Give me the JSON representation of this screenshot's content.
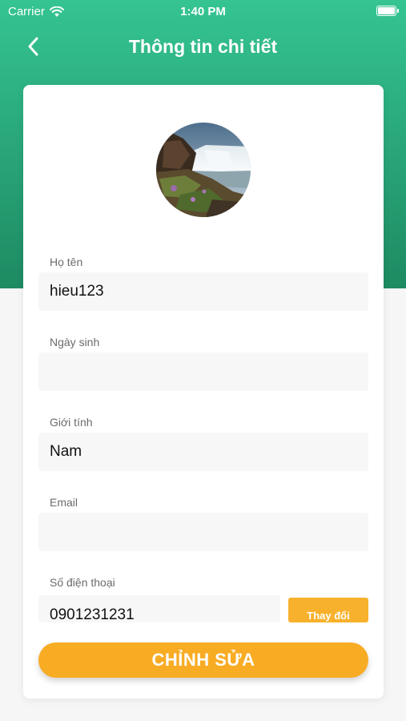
{
  "status_bar": {
    "carrier": "Carrier",
    "time": "1:40 PM",
    "battery_level": 1.0
  },
  "header": {
    "title": "Thông tin chi tiết",
    "back_icon": "chevron-left-icon"
  },
  "avatar": {
    "image": "waterfall landscape photo"
  },
  "fields": [
    {
      "label": "Họ tên",
      "value": "hieu123"
    },
    {
      "label": "Ngày sinh",
      "value": ""
    },
    {
      "label": "Giới tính",
      "value": "Nam"
    },
    {
      "label": "Email",
      "value": ""
    },
    {
      "label": "Số điện thoại",
      "value": "0901231231"
    }
  ],
  "phone_change_label": "Thay đổi",
  "edit_button_label": "CHỈNH SỬA",
  "colors": {
    "header_top": "#35c492",
    "header_bottom": "#1e8a62",
    "accent": "#f8ac24",
    "input_bg": "#f7f7f7"
  }
}
